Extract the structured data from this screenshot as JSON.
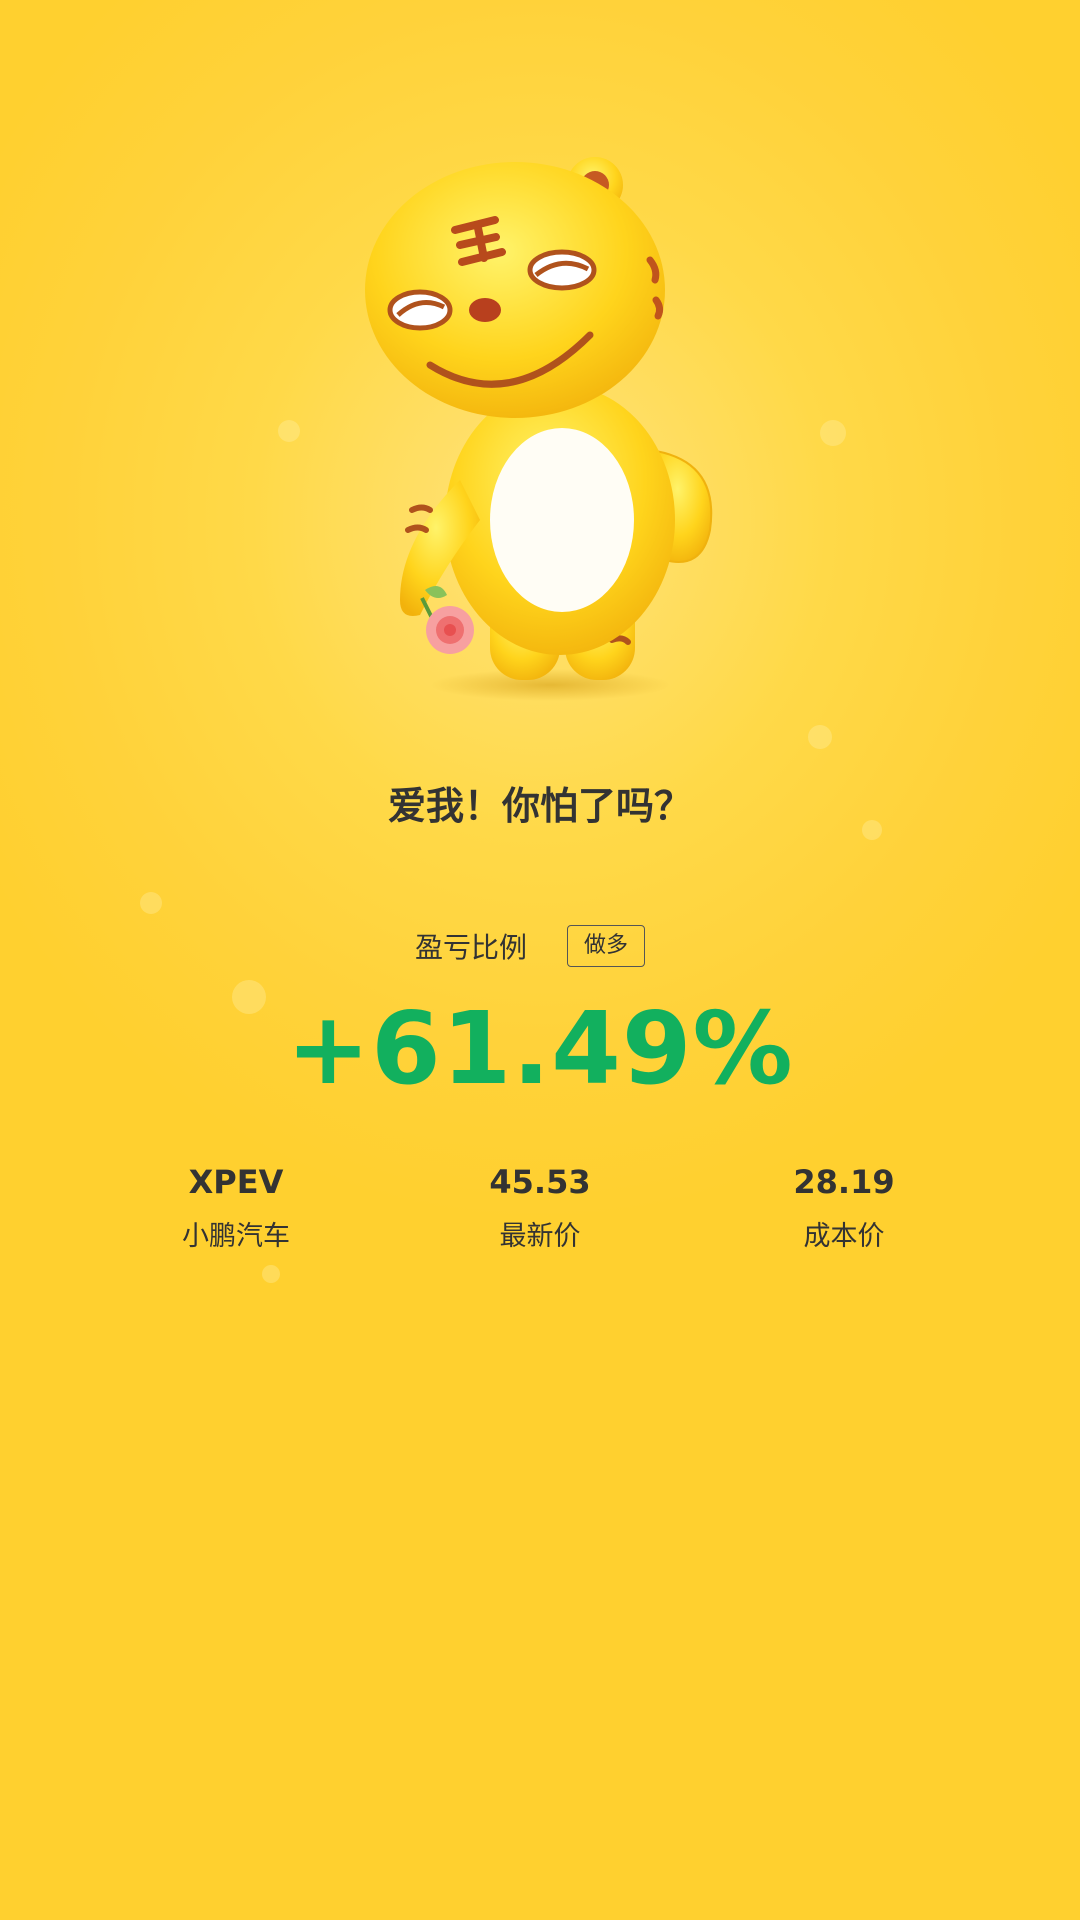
{
  "title": "爱我！你怕了吗？",
  "profit_ratio": {
    "label": "盈亏比例",
    "direction": "做多",
    "value": "+61.49%",
    "value_color": "#12b05e"
  },
  "stock": {
    "ticker": "XPEV",
    "name": "小鹏汽车"
  },
  "latest_price": {
    "value": "45.53",
    "label": "最新价"
  },
  "cost_price": {
    "value": "28.19",
    "label": "成本价"
  },
  "mascot": {
    "icon": "tiger-mascot-icon"
  },
  "colors": {
    "background": "#ffd23a",
    "text": "#333333",
    "gain": "#12b05e"
  }
}
